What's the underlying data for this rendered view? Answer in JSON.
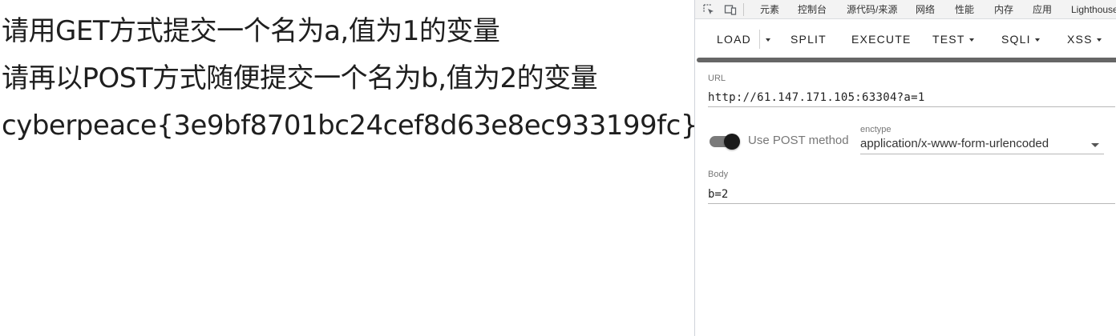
{
  "page": {
    "lines": [
      "请用GET方式提交一个名为a,值为1的变量",
      "请再以POST方式随便提交一个名为b,值为2的变量",
      "cyberpeace{3e9bf8701bc24cef8d63e8ec933199fc}"
    ]
  },
  "devtools": {
    "icons": [
      "inspect-element-icon",
      "device-toolbar-icon"
    ],
    "tabs": [
      "元素",
      "控制台",
      "源代码/来源",
      "网络",
      "性能",
      "内存",
      "应用",
      "Lighthouse"
    ]
  },
  "hackbar": {
    "toolbar": {
      "load": "LOAD",
      "split": "SPLIT",
      "execute": "EXECUTE",
      "test": "TEST",
      "sqli": "SQLI",
      "xss": "XSS"
    },
    "url": {
      "label": "URL",
      "value": "http://61.147.171.105:63304?a=1"
    },
    "post": {
      "label": "Use POST method",
      "enabled": true
    },
    "enctype": {
      "label": "enctype",
      "value": "application/x-www-form-urlencoded"
    },
    "body": {
      "label": "Body",
      "value": "b=2"
    }
  },
  "colors": {
    "toggle_track": "#7a7a7a",
    "toggle_thumb": "#1a1a1a",
    "divider": "#666666"
  }
}
